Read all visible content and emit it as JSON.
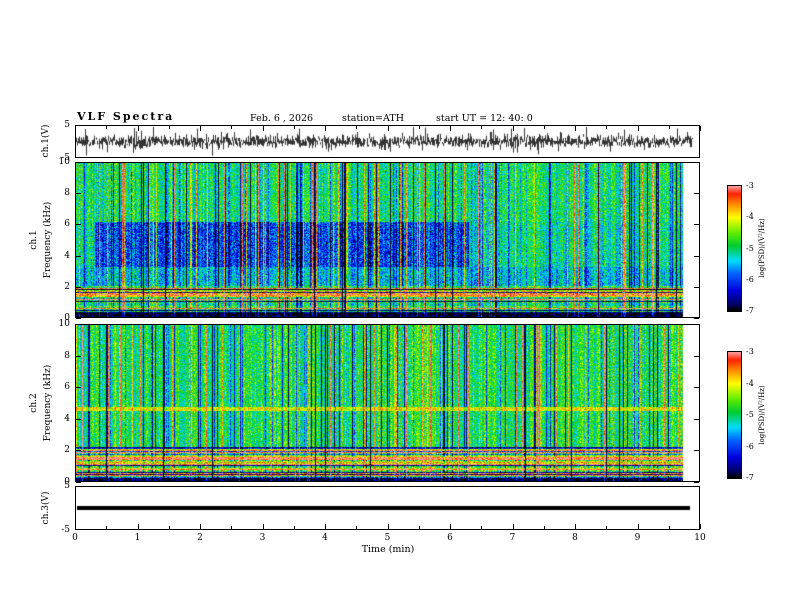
{
  "header": {
    "title": "VLF Spectra",
    "date": "Feb. 6  , 2026",
    "station": "station=ATH",
    "start_ut": "start UT =   12: 40: 0"
  },
  "axes": {
    "time_label": "Time (min)",
    "time_ticks": [
      "0",
      "1",
      "2",
      "3",
      "4",
      "5",
      "6",
      "7",
      "8",
      "9",
      "10"
    ],
    "freq_ticks": [
      "10",
      "8",
      "6",
      "4",
      "2",
      "0"
    ],
    "volt_ticks": [
      "5",
      "-5"
    ],
    "ch1_wave_label": "ch.1(V)",
    "ch1_spec_label_channel": "ch.1",
    "ch2_spec_label_channel": "ch.2",
    "freq_axis_label": "Frequency (kHz)",
    "ch3_wave_label": "ch.3(V)"
  },
  "colorbar": {
    "label": "log(PSD)/(V²/Hz)",
    "ticks": [
      "-3",
      "-4",
      "-5",
      "-6",
      "-7"
    ],
    "colormap": [
      [
        "#000000",
        0
      ],
      [
        "#000066",
        0.05
      ],
      [
        "#0000dd",
        0.16
      ],
      [
        "#0066ff",
        0.3
      ],
      [
        "#00ddff",
        0.4
      ],
      [
        "#00cc33",
        0.52
      ],
      [
        "#66ee00",
        0.63
      ],
      [
        "#ffff00",
        0.75
      ],
      [
        "#ff8800",
        0.86
      ],
      [
        "#ff2200",
        0.94
      ],
      [
        "#ff9999",
        1
      ]
    ]
  },
  "chart_data": [
    {
      "type": "line",
      "name": "ch1_waveform",
      "xlabel": "Time (min)",
      "ylabel": "ch.1(V)",
      "xlim": [
        0,
        10
      ],
      "ylim": [
        -5,
        5
      ],
      "x_end": 9.9,
      "seed": 5,
      "rms_v": 1.1,
      "spike_prob": 0.05,
      "spike_amp_v": [
        2.5,
        4.8
      ],
      "description": "Broadband noise centered on 0 V with frequent impulsive spikes reaching toward ±5 V across the full 0–10 min record"
    },
    {
      "type": "heatmap",
      "name": "ch1_spectrogram",
      "xlabel": "Time (min)",
      "ylabel": "Frequency (kHz)",
      "zlabel": "log(PSD)/(V²/Hz)",
      "xlim": [
        0,
        10
      ],
      "ylim": [
        0,
        10
      ],
      "zlim": [
        -7,
        -3
      ],
      "x_end": 9.75,
      "seed": 11,
      "base_level": -5.0,
      "noise_sd": 0.55,
      "vertical_streaks": {
        "bright_prob": 0.1,
        "dark_prob": 0.1,
        "black_prob": 0.012
      },
      "bands": [
        {
          "f0": 0.0,
          "f1": 0.25,
          "bias": -2.0,
          "mode": "flat"
        },
        {
          "f0": 0.25,
          "f1": 2.05,
          "bias": 0.0,
          "mode": "hlines"
        },
        {
          "f0": 2.05,
          "f1": 3.3,
          "bias": -0.45,
          "mode": "flat"
        },
        {
          "f0": 3.3,
          "f1": 6.2,
          "bias": -0.15,
          "mode": "flat"
        }
      ],
      "patch": {
        "f0": 3.3,
        "f1": 6.2,
        "t0": 0.3,
        "t1": 6.3,
        "bias": -0.85
      },
      "description": "Speckled VLF spectrogram: ~-5 green background, dense vertical impulsive streaks (yellow/red) and dropouts (blue/black), suppressed blue region 3.3–6.2 kHz before ~6.3 min, striated horizontal lines below ~2 kHz, near-black band below 0.25 kHz, data ends ~9.75 min"
    },
    {
      "type": "heatmap",
      "name": "ch2_spectrogram",
      "xlabel": "Time (min)",
      "ylabel": "Frequency (kHz)",
      "zlabel": "log(PSD)/(V²/Hz)",
      "xlim": [
        0,
        10
      ],
      "ylim": [
        0,
        10
      ],
      "zlim": [
        -7,
        -3
      ],
      "x_end": 9.75,
      "seed": 23,
      "base_level": -4.9,
      "noise_sd": 0.5,
      "vertical_streaks": {
        "bright_prob": 0.08,
        "dark_prob": 0.12,
        "black_prob": 0.015
      },
      "bands": [
        {
          "f0": 0.0,
          "f1": 0.2,
          "bias": -2.0,
          "mode": "flat"
        },
        {
          "f0": 0.2,
          "f1": 2.3,
          "bias": 0.2,
          "mode": "hlines"
        },
        {
          "f0": 4.5,
          "f1": 4.75,
          "bias": 0.9,
          "mode": "flat"
        }
      ],
      "patch": null,
      "description": "Similar speckled spectrogram, more uniform green/cyan above 2.3 kHz with vertical streaks and black dropout columns; strong alternating red/yellow/green/dark horizontal striations below ~2.3 kHz; thin bright line near 4.6 kHz"
    },
    {
      "type": "line",
      "name": "ch3_waveform",
      "xlabel": "Time (min)",
      "ylabel": "ch.3(V)",
      "xlim": [
        0,
        10
      ],
      "ylim": [
        -5,
        5
      ],
      "x_end": 9.85,
      "constant": 0,
      "description": "Flat thick line at 0 V for the whole record"
    }
  ]
}
